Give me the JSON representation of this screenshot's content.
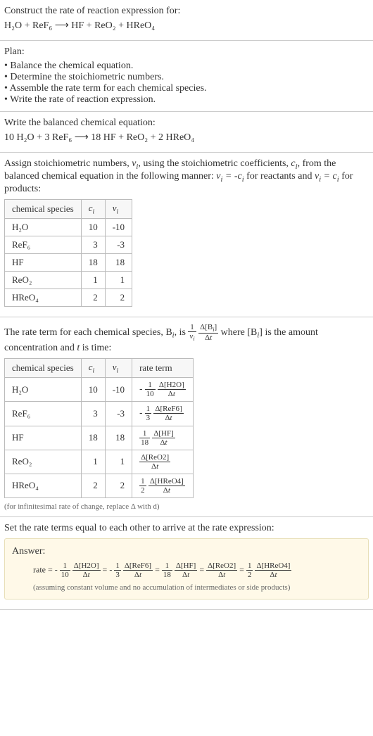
{
  "intro": {
    "title": "Construct the rate of reaction expression for:",
    "equation": "H₂O + ReF₆ ⟶ HF + ReO₂ + HReO₄"
  },
  "plan": {
    "title": "Plan:",
    "items": [
      "Balance the chemical equation.",
      "Determine the stoichiometric numbers.",
      "Assemble the rate term for each chemical species.",
      "Write the rate of reaction expression."
    ]
  },
  "balanced": {
    "title": "Write the balanced chemical equation:",
    "equation": "10 H₂O + 3 ReF₆ ⟶ 18 HF + ReO₂ + 2 HReO₄"
  },
  "stoich": {
    "intro_1": "Assign stoichiometric numbers, ",
    "intro_2": ", using the stoichiometric coefficients, ",
    "intro_3": ", from the balanced chemical equation in the following manner: ",
    "intro_4": " for reactants and ",
    "intro_5": " for products:",
    "headers": {
      "species": "chemical species",
      "c": "cᵢ",
      "nu": "νᵢ"
    },
    "rows": [
      {
        "species": "H₂O",
        "c": "10",
        "nu": "-10"
      },
      {
        "species": "ReF₆",
        "c": "3",
        "nu": "-3"
      },
      {
        "species": "HF",
        "c": "18",
        "nu": "18"
      },
      {
        "species": "ReO₂",
        "c": "1",
        "nu": "1"
      },
      {
        "species": "HReO₄",
        "c": "2",
        "nu": "2"
      }
    ]
  },
  "rateterm": {
    "intro_1": "The rate term for each chemical species, B",
    "intro_2": ", is ",
    "intro_3": " where [B",
    "intro_4": "] is the amount concentration and ",
    "intro_5": " is time:",
    "headers": {
      "species": "chemical species",
      "c": "cᵢ",
      "nu": "νᵢ",
      "rate": "rate term"
    },
    "note": "(for infinitesimal rate of change, replace Δ with d)"
  },
  "final": {
    "title": "Set the rate terms equal to each other to arrive at the rate expression:",
    "answer_label": "Answer:",
    "note": "(assuming constant volume and no accumulation of intermediates or side products)"
  },
  "chart_data": {
    "type": "table",
    "species": [
      "H₂O",
      "ReF₆",
      "HF",
      "ReO₂",
      "HReO₄"
    ],
    "c_i": [
      10,
      3,
      18,
      1,
      1,
      2
    ],
    "nu_i": [
      -10,
      -3,
      18,
      1,
      2
    ],
    "rate_terms": [
      "-(1/10) Δ[H2O]/Δt",
      "-(1/3) Δ[ReF6]/Δt",
      "(1/18) Δ[HF]/Δt",
      "Δ[ReO2]/Δt",
      "(1/2) Δ[HReO4]/Δt"
    ],
    "rate_expression": "rate = -(1/10) Δ[H2O]/Δt = -(1/3) Δ[ReF6]/Δt = (1/18) Δ[HF]/Δt = Δ[ReO2]/Δt = (1/2) Δ[HReO4]/Δt"
  }
}
